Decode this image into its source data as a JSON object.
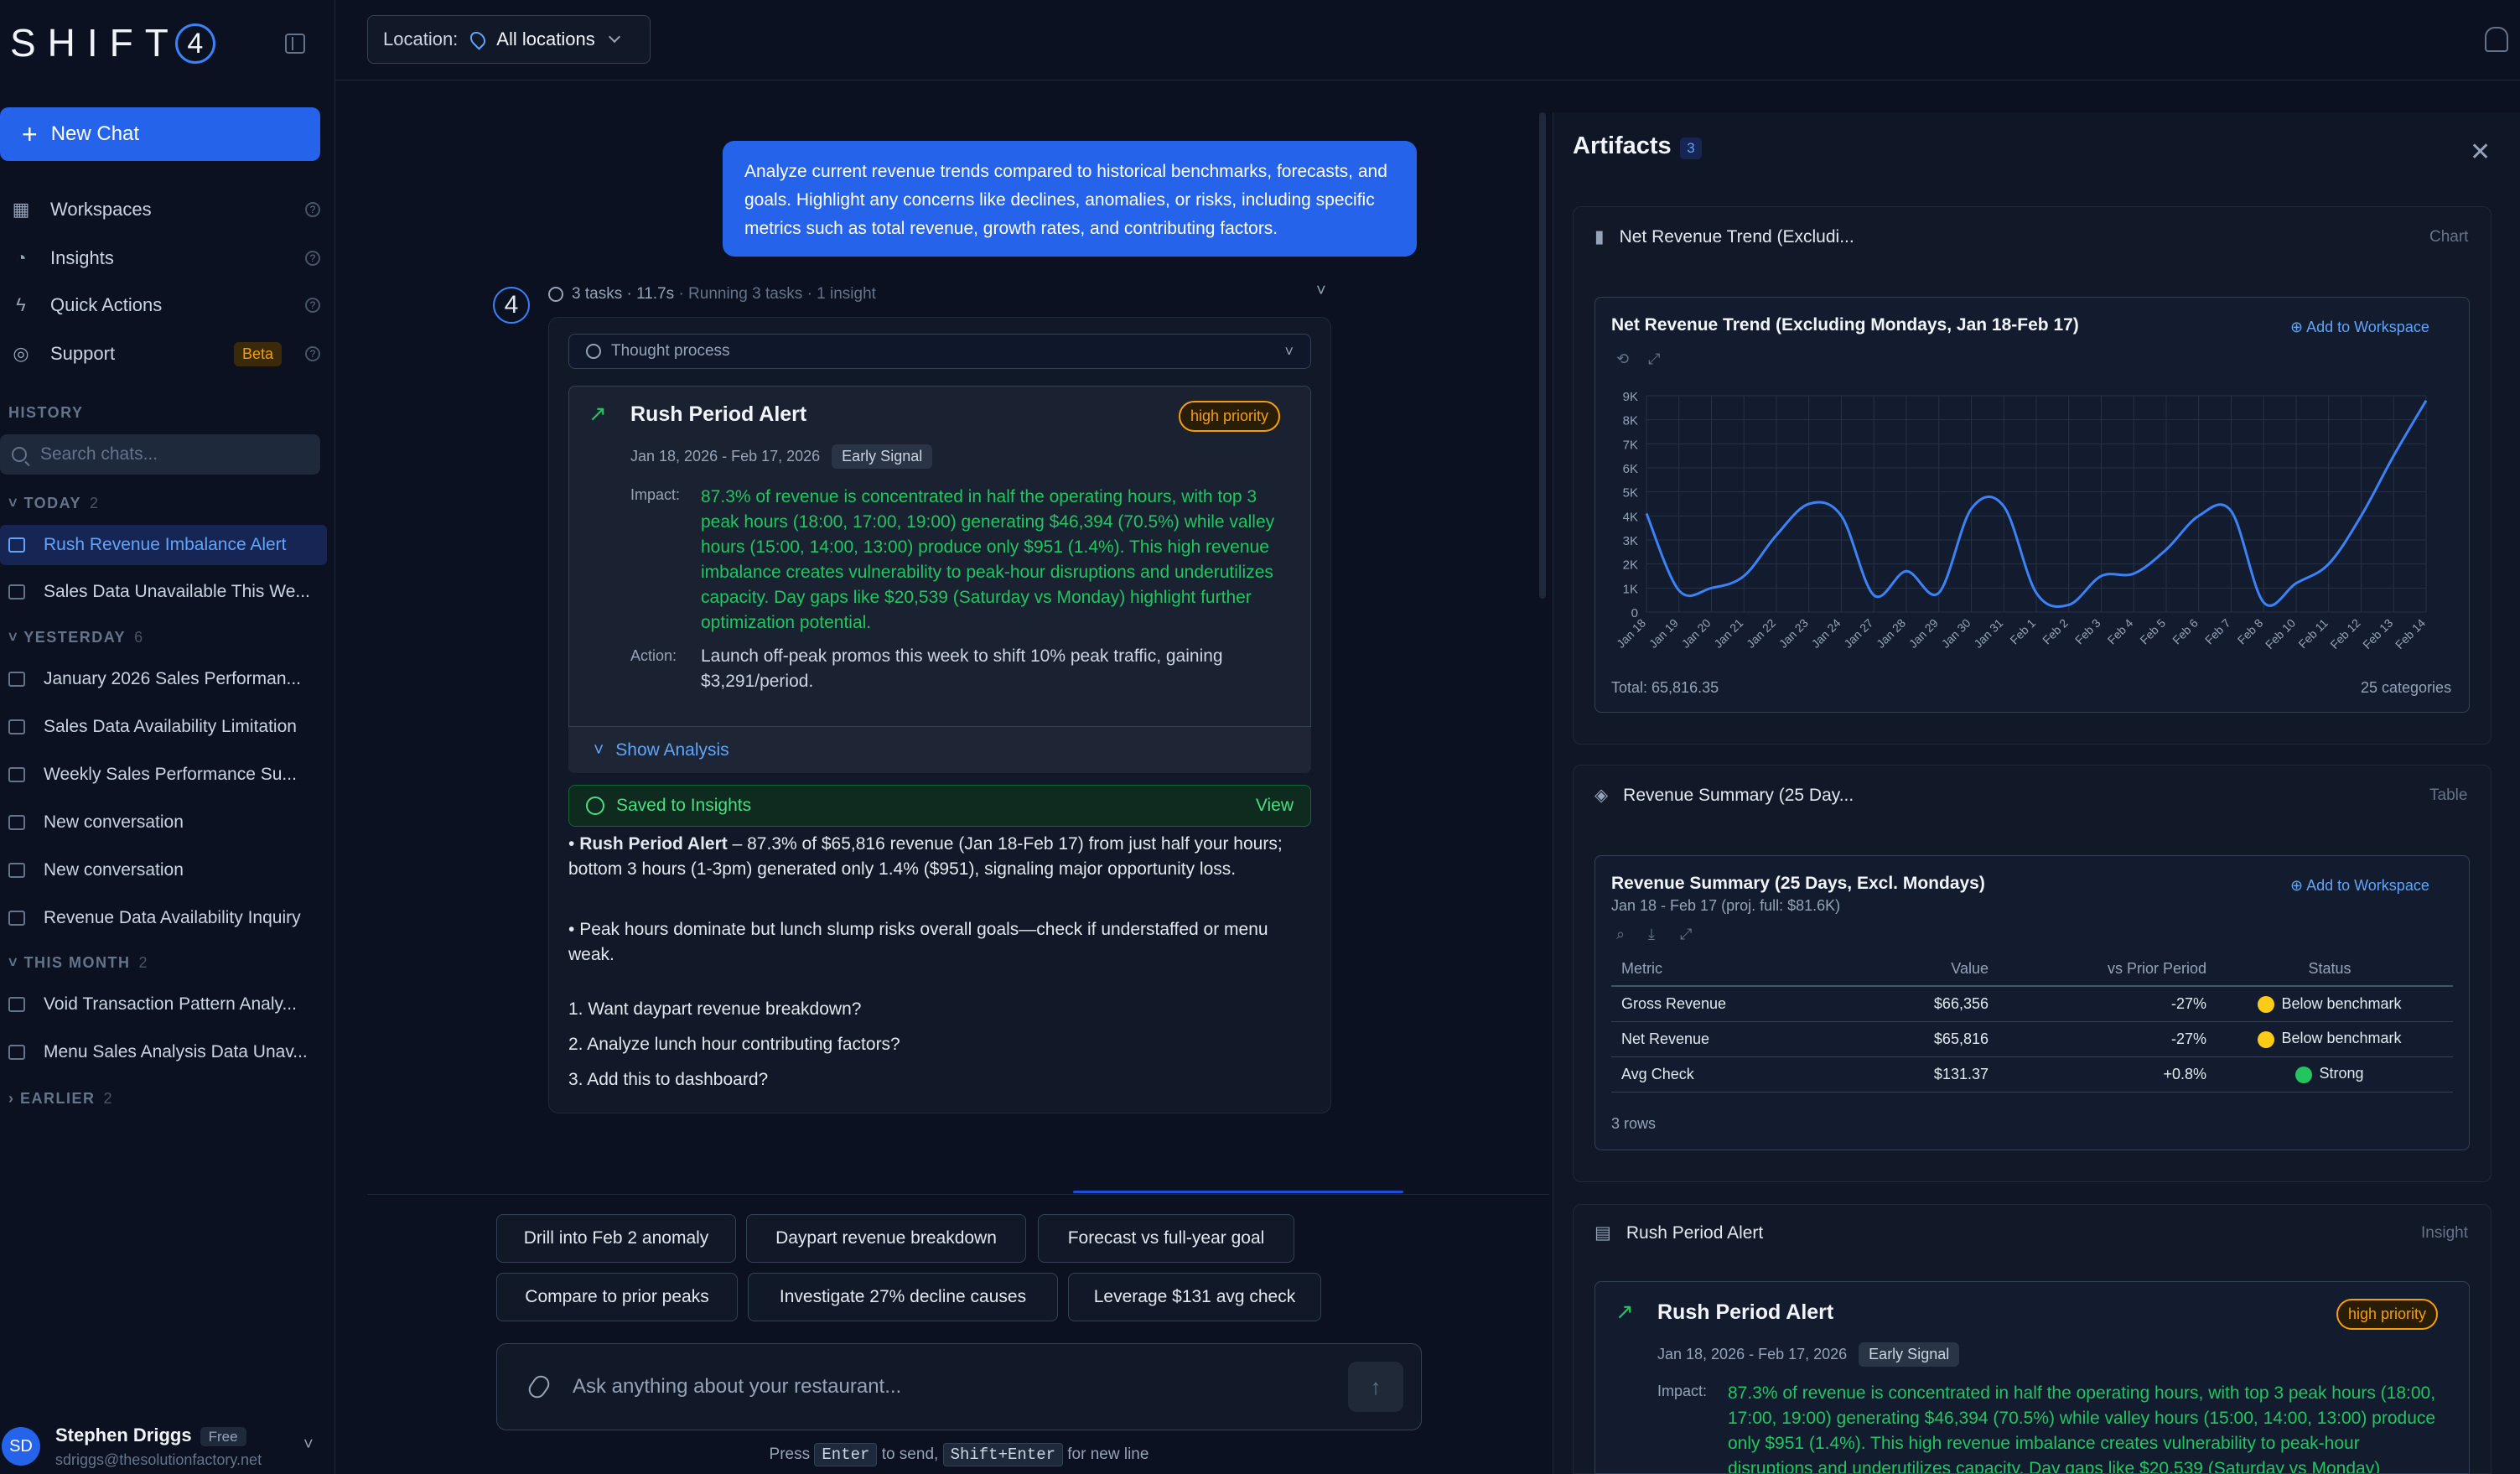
{
  "app": {
    "brand": "SHIFT",
    "brand_mark": "4"
  },
  "sidebar": {
    "new_chat": "New Chat",
    "nav": [
      {
        "label": "Workspaces",
        "icon": "grid-icon"
      },
      {
        "label": "Insights",
        "icon": "insights-icon"
      },
      {
        "label": "Quick Actions",
        "icon": "bolt-icon"
      },
      {
        "label": "Support",
        "icon": "support-icon",
        "badge": "Beta"
      }
    ],
    "history_label": "HISTORY",
    "search_placeholder": "Search chats...",
    "groups": {
      "today": {
        "label": "TODAY",
        "count": "2",
        "items": [
          "Rush Revenue Imbalance Alert",
          "Sales Data Unavailable This We..."
        ]
      },
      "yesterday": {
        "label": "YESTERDAY",
        "count": "6",
        "items": [
          "January 2026 Sales Performan...",
          "Sales Data Availability Limitation",
          "Weekly Sales Performance Su...",
          "New conversation",
          "New conversation",
          "Revenue Data Availability Inquiry"
        ]
      },
      "this_month": {
        "label": "THIS MONTH",
        "count": "2",
        "items": [
          "Void Transaction Pattern Analy...",
          "Menu Sales Analysis Data Unav..."
        ]
      },
      "earlier": {
        "label": "EARLIER",
        "count": "2"
      }
    },
    "user": {
      "initials": "SD",
      "name": "Stephen Driggs",
      "plan": "Free",
      "email": "sdriggs@thesolutionfactory.net"
    }
  },
  "topbar": {
    "location_label": "Location:",
    "location_value": "All locations"
  },
  "chat": {
    "user_message": "Analyze current revenue trends compared to historical benchmarks, forecasts, and goals. Highlight any concerns like declines, anomalies, or risks, including specific metrics such as total revenue, growth rates, and contributing factors.",
    "bot_mark": "4",
    "task_summary": "3 tasks · 11.7s",
    "task_status": "· Running 3 tasks · 1 insight",
    "thought_process": "Thought process",
    "insight": {
      "title": "Rush Period Alert",
      "priority": "high priority",
      "dates": "Jan 18, 2026 - Feb 17, 2026",
      "signal": "Early Signal",
      "impact_label": "Impact:",
      "impact": "87.3% of revenue is concentrated in half the operating hours, with top 3 peak hours (18:00, 17:00, 19:00) generating $46,394 (70.5%) while valley hours (15:00, 14:00, 13:00) produce only $951 (1.4%). This high revenue imbalance creates vulnerability to peak-hour disruptions and underutilizes capacity. Day gaps like $20,539 (Saturday vs Monday) highlight further optimization potential.",
      "action_label": "Action:",
      "action": "Launch off-peak promos this week to shift 10% peak traffic, gaining $3,291/period.",
      "show_analysis": "Show Analysis"
    },
    "saved": {
      "label": "Saved to Insights",
      "view": "View"
    },
    "bullets": [
      {
        "bold": "Rush Period Alert",
        "text": " – 87.3% of $65,816 revenue (Jan 18-Feb 17) from just half your hours; bottom 3 hours (1-3pm) generated only 1.4% ($951), signaling major opportunity loss."
      },
      {
        "bold": "",
        "text": "Peak hours dominate but lunch slump risks overall goals—check if understaffed or menu weak."
      }
    ],
    "questions": [
      "1. Want daypart revenue breakdown?",
      "2. Analyze lunch hour contributing factors?",
      "3. Add this to dashboard?"
    ],
    "suggestions": [
      "Drill into Feb 2 anomaly",
      "Daypart revenue breakdown",
      "Forecast vs full-year goal",
      "Compare to prior peaks",
      "Investigate 27% decline causes",
      "Leverage $131 avg check"
    ],
    "composer_placeholder": "Ask anything about your restaurant...",
    "hint": {
      "press": "Press",
      "enter": "Enter",
      "to_send": "to send,",
      "shift_enter": "Shift+Enter",
      "new_line": "for new line"
    }
  },
  "artifacts": {
    "title": "Artifacts",
    "count": "3",
    "chart_panel": {
      "header": "Net Revenue Trend (Excludi...",
      "type": "Chart",
      "title": "Net Revenue Trend (Excluding Mondays, Jan 18-Feb 17)",
      "add": "Add to Workspace",
      "total": "Total: 65,816.35",
      "categories_count": "25 categories"
    },
    "table_panel": {
      "header": "Revenue Summary (25 Day...",
      "type": "Table",
      "title": "Revenue Summary (25 Days, Excl. Mondays)",
      "subtitle": "Jan 18 - Feb 17 (proj. full: $81.6K)",
      "add": "Add to Workspace",
      "columns": [
        "Metric",
        "Value",
        "vs Prior Period",
        "Status"
      ],
      "rows": [
        {
          "metric": "Gross Revenue",
          "value": "$66,356",
          "vs": "-27%",
          "status": "Below benchmark",
          "color": "#facc15"
        },
        {
          "metric": "Net Revenue",
          "value": "$65,816",
          "vs": "-27%",
          "status": "Below benchmark",
          "color": "#facc15"
        },
        {
          "metric": "Avg Check",
          "value": "$131.37",
          "vs": "+0.8%",
          "status": "Strong",
          "color": "#22c55e"
        }
      ],
      "row_count": "3 rows"
    },
    "insight_panel": {
      "header": "Rush Period Alert",
      "type": "Insight"
    }
  },
  "colors": {
    "accent": "#2563eb",
    "positive": "#22c55e",
    "warning": "#f59e0b",
    "line": "#3b82f6"
  },
  "chart_data": {
    "type": "line",
    "title": "Net Revenue Trend (Excluding Mondays, Jan 18-Feb 17)",
    "categories": [
      "Jan 18",
      "Jan 19",
      "Jan 20",
      "Jan 21",
      "Jan 22",
      "Jan 23",
      "Jan 24",
      "Jan 27",
      "Jan 28",
      "Jan 29",
      "Jan 30",
      "Jan 31",
      "Feb 1",
      "Feb 2",
      "Feb 3",
      "Feb 4",
      "Feb 5",
      "Feb 6",
      "Feb 7",
      "Feb 8",
      "Feb 10",
      "Feb 11",
      "Feb 12",
      "Feb 13",
      "Feb 14"
    ],
    "values": [
      4100,
      900,
      1000,
      1500,
      3200,
      4500,
      4000,
      700,
      1700,
      800,
      4300,
      4400,
      800,
      300,
      1500,
      1600,
      2600,
      4000,
      4200,
      400,
      1200,
      2000,
      4000,
      6500,
      8800
    ],
    "ylim": [
      0,
      9000
    ],
    "yticks": [
      "0",
      "1K",
      "2K",
      "3K",
      "4K",
      "5K",
      "6K",
      "7K",
      "8K",
      "9K"
    ],
    "grid": true
  }
}
